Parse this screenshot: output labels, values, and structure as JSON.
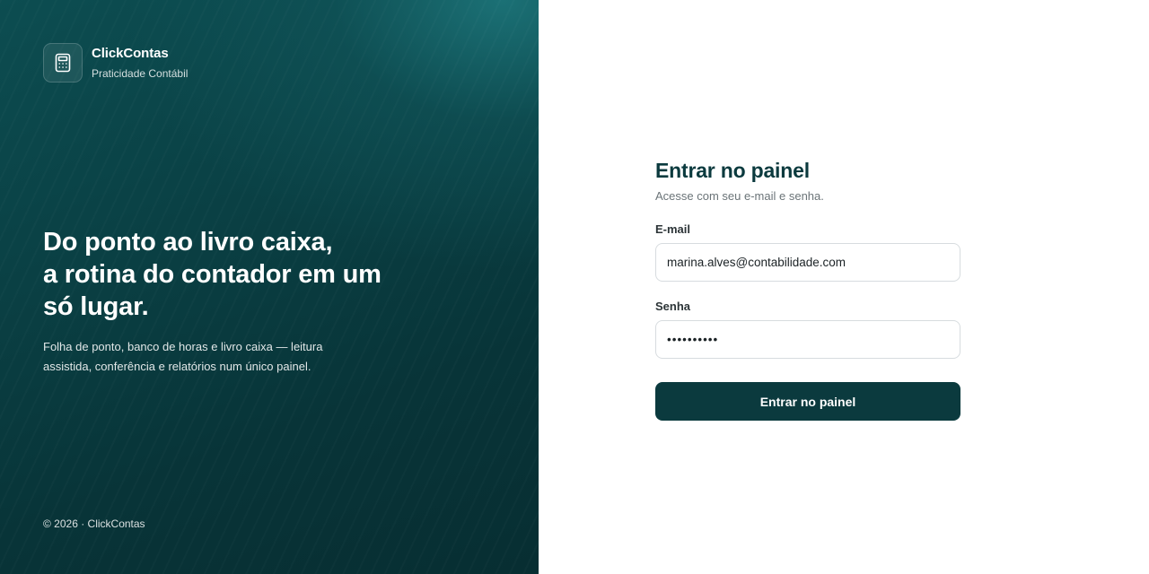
{
  "brand": {
    "name": "ClickContas",
    "tagline": "Praticidade Contábil",
    "icon": "calculator-icon"
  },
  "hero": {
    "title_lines": [
      "Do ponto ao livro caixa,",
      "a rotina do contador em um",
      "só lugar."
    ],
    "description": "Folha de ponto, banco de horas e livro caixa — leitura assistida, conferência e relatórios num único painel."
  },
  "footer": {
    "copyright": "© 2026 · ClickContas"
  },
  "login": {
    "title": "Entrar no painel",
    "subtitle": "Acesse com seu e-mail e senha.",
    "email_label": "E-mail",
    "email_value": "marina.alves@contabilidade.com",
    "password_label": "Senha",
    "password_value": "••••••••••",
    "submit_label": "Entrar no painel"
  },
  "colors": {
    "brand_dark": "#0b3a3e",
    "panel_teal": "#0a4145"
  }
}
